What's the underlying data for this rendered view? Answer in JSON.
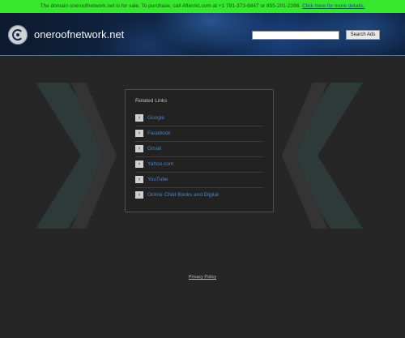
{
  "banner": {
    "text": "The domain oneroofnetwork.net is for sale. To purchase, call Afternic.com at +1 781-373-6847 or 855-201-2286.",
    "link": "Click here for more details."
  },
  "header": {
    "site_title": "oneroofnetwork.net",
    "search_placeholder": "",
    "search_button": "Search Ads",
    "logo_icon": "globe-logo-icon"
  },
  "related": {
    "title": "Related Links",
    "items": [
      {
        "label": "Google"
      },
      {
        "label": "Facebook"
      },
      {
        "label": "Gmail"
      },
      {
        "label": "Yahoo.com"
      },
      {
        "label": "YouTube"
      },
      {
        "label": "Online Child Books and Digital"
      }
    ]
  },
  "footer": {
    "privacy_link": "Privacy Policy"
  },
  "colors": {
    "banner_bg": "#35e82e",
    "page_bg": "#262626",
    "link": "#4a86c5",
    "chevron_left": "#2b3a38",
    "chevron_right": "#2b3a38"
  }
}
